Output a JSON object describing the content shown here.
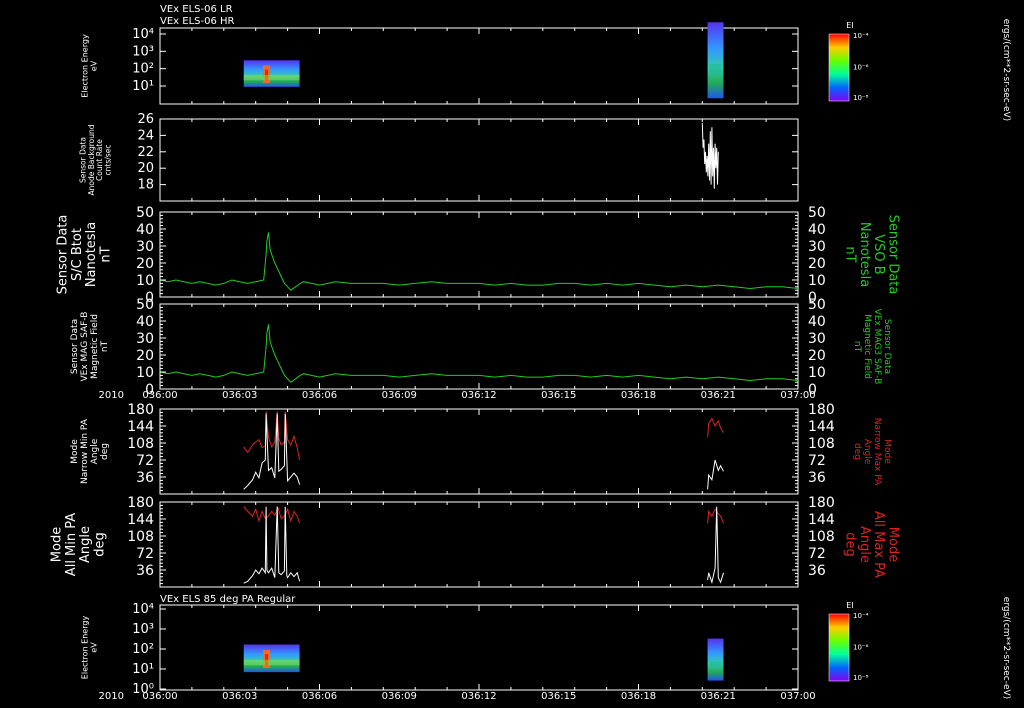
{
  "header": {
    "line1": "VEx ELS-06 LR",
    "line2": "VEx ELS-06 HR"
  },
  "year": "2010",
  "time_ticks": [
    "036:00",
    "036:03",
    "036:06",
    "036:09",
    "036:12",
    "036:15",
    "036:18",
    "036:21",
    "037:00"
  ],
  "colors": {
    "background": "#000000",
    "axis": "#ffffff",
    "mag": "#22cc22",
    "max_pa": "#dd2222",
    "min_pa": "#ffffff",
    "right_label_green": "#22cc22",
    "right_label_red": "#dd2222"
  },
  "colorbar": {
    "label": "EI",
    "ticks": [
      "10⁻⁴",
      "10⁻⁶",
      "10⁻⁸"
    ]
  },
  "colorbar_units": "ergs/(cm**2-sr-sec-eV)",
  "chart_data": [
    {
      "type": "heatmap",
      "id": "spec1",
      "ylabel": [
        "Electron Energy",
        "eV"
      ],
      "yticks": [
        "10⁴",
        "10³",
        "10²",
        "10¹"
      ],
      "ylog": true,
      "ylim": [
        1,
        10000
      ],
      "xlim": [
        "036:00",
        "037:00"
      ],
      "blocks": [
        {
          "t0": 36.0525,
          "t1": 36.0875,
          "e0": 8,
          "e1": 200
        },
        {
          "t0": 36.3433,
          "t1": 36.3533,
          "e0": 2,
          "e1": 20000
        }
      ]
    },
    {
      "type": "line",
      "id": "anode",
      "ylabel": [
        "Sensor Data",
        "Anode Background",
        "Count Rate",
        "cnts/sec"
      ],
      "ylim": [
        16,
        26
      ],
      "yticks": [
        "26",
        "24",
        "22",
        "20",
        "18"
      ],
      "series": [
        {
          "color": "#ffffff",
          "x": [
            36.34,
            36.3405,
            36.341,
            36.3415,
            36.342,
            36.3425,
            36.343,
            36.3435,
            36.344,
            36.3445,
            36.345,
            36.3455,
            36.346,
            36.3465,
            36.347,
            36.3475,
            36.348,
            36.3485,
            36.349,
            36.3495,
            36.35
          ],
          "y": [
            25.5,
            22.5,
            23.5,
            20.5,
            22.0,
            19.5,
            21.5,
            19.0,
            23.0,
            18.5,
            24.5,
            18.0,
            25.0,
            19.0,
            22.5,
            17.5,
            23.0,
            20.0,
            22.5,
            18.0,
            22.0
          ]
        }
      ]
    },
    {
      "type": "line",
      "id": "mag1",
      "ylabel": [
        "Sensor Data",
        "S/C Btot",
        "Nanotesla",
        "nT"
      ],
      "rlabel": [
        "Sensor Data",
        "VSO B",
        "Nanotesla",
        "nT"
      ],
      "ylim": [
        0,
        50
      ],
      "yticks": [
        "50",
        "40",
        "30",
        "20",
        "10",
        "0"
      ],
      "series": [
        {
          "color": "#22cc22",
          "x": [
            36.0,
            36.005,
            36.01,
            36.015,
            36.02,
            36.025,
            36.03,
            36.035,
            36.04,
            36.045,
            36.05,
            36.055,
            36.06,
            36.065,
            36.0665,
            36.067,
            36.068,
            36.069,
            36.07,
            36.072,
            36.074,
            36.076,
            36.078,
            36.08,
            36.082,
            36.085,
            36.088,
            36.09,
            36.095,
            36.1,
            36.11,
            36.12,
            36.13,
            36.14,
            36.15,
            36.16,
            36.17,
            36.18,
            36.19,
            36.2,
            36.21,
            36.22,
            36.23,
            36.24,
            36.25,
            36.26,
            36.27,
            36.28,
            36.29,
            36.3,
            36.31,
            36.32,
            36.33,
            36.34,
            36.35,
            36.36,
            36.37,
            36.38,
            36.39,
            36.4
          ],
          "y": [
            10,
            9,
            10,
            9,
            8,
            9,
            8,
            7,
            8,
            10,
            9,
            8,
            9,
            10,
            25,
            33,
            38,
            28,
            25,
            20,
            16,
            12,
            8,
            6,
            4,
            6,
            8,
            9,
            8,
            7,
            9,
            8,
            8,
            8,
            7,
            8,
            9,
            8,
            8,
            8,
            7,
            8,
            7,
            7,
            8,
            8,
            7,
            8,
            7,
            8,
            7,
            6,
            7,
            6,
            7,
            6,
            5,
            6,
            6,
            5
          ]
        }
      ]
    },
    {
      "type": "line",
      "id": "mag2",
      "ylabel": [
        "Sensor Data",
        "VEx MAG SAF-B",
        "Magnetic Field",
        "nT"
      ],
      "rlabel": [
        "Sensor Data",
        "VEx MAG3 SAF-B",
        "Magnetic Field",
        "nT"
      ],
      "ylim": [
        0,
        50
      ],
      "yticks": [
        "50",
        "40",
        "30",
        "20",
        "10",
        "0"
      ],
      "series": [
        {
          "color": "#22cc22",
          "x": [
            36.0,
            36.005,
            36.01,
            36.015,
            36.02,
            36.025,
            36.03,
            36.035,
            36.04,
            36.045,
            36.05,
            36.055,
            36.06,
            36.065,
            36.0665,
            36.067,
            36.068,
            36.069,
            36.07,
            36.072,
            36.074,
            36.076,
            36.078,
            36.08,
            36.082,
            36.085,
            36.088,
            36.09,
            36.095,
            36.1,
            36.11,
            36.12,
            36.13,
            36.14,
            36.15,
            36.16,
            36.17,
            36.18,
            36.19,
            36.2,
            36.21,
            36.22,
            36.23,
            36.24,
            36.25,
            36.26,
            36.27,
            36.28,
            36.29,
            36.3,
            36.31,
            36.32,
            36.33,
            36.34,
            36.35,
            36.36,
            36.37,
            36.38,
            36.39,
            36.4
          ],
          "y": [
            10,
            9,
            10,
            9,
            8,
            9,
            8,
            7,
            8,
            10,
            9,
            8,
            9,
            10,
            25,
            33,
            38,
            28,
            25,
            20,
            16,
            12,
            8,
            6,
            4,
            6,
            8,
            9,
            8,
            7,
            9,
            8,
            8,
            8,
            7,
            8,
            9,
            8,
            8,
            8,
            7,
            8,
            7,
            7,
            8,
            8,
            7,
            8,
            7,
            8,
            7,
            6,
            7,
            6,
            7,
            6,
            5,
            6,
            6,
            5
          ]
        }
      ]
    },
    {
      "type": "line",
      "id": "pa_narrow",
      "ylabel": [
        "Mode",
        "Narrow Min PA",
        "Angle",
        "deg"
      ],
      "rlabel": [
        "Mode",
        "Narrow Max PA",
        "Angle",
        "deg"
      ],
      "ylim": [
        0,
        180
      ],
      "yticks": [
        "180",
        "144",
        "108",
        "72",
        "36"
      ],
      "series": [
        {
          "name": "Narrow Max PA",
          "color": "#dd2222",
          "x": [
            36.0525,
            36.055,
            36.058,
            36.06,
            36.062,
            36.064,
            36.066,
            36.0665,
            36.068,
            36.07,
            36.072,
            36.0735,
            36.0745,
            36.076,
            36.078,
            36.0785,
            36.08,
            36.082,
            36.084,
            36.086,
            36.0875
          ],
          "y": [
            100,
            88,
            104,
            110,
            115,
            98,
            102,
            175,
            120,
            100,
            110,
            175,
            118,
            104,
            110,
            175,
            115,
            104,
            122,
            98,
            72
          ]
        },
        {
          "name": "Narrow Min PA",
          "color": "#ffffff",
          "x": [
            36.0525,
            36.055,
            36.058,
            36.06,
            36.062,
            36.064,
            36.066,
            36.0665,
            36.068,
            36.07,
            36.072,
            36.0735,
            36.0745,
            36.076,
            36.078,
            36.0785,
            36.08,
            36.082,
            36.084,
            36.086,
            36.0875
          ],
          "y": [
            10,
            18,
            30,
            46,
            34,
            66,
            72,
            170,
            50,
            56,
            34,
            170,
            48,
            52,
            60,
            170,
            28,
            36,
            44,
            36,
            20
          ]
        },
        {
          "name": "Narrow Max PA",
          "color": "#dd2222",
          "x": [
            36.3433,
            36.344,
            36.346,
            36.348,
            36.35,
            36.3515,
            36.3533
          ],
          "y": [
            120,
            150,
            160,
            144,
            155,
            140,
            130
          ]
        },
        {
          "name": "Narrow Min PA",
          "color": "#ffffff",
          "x": [
            36.3433,
            36.344,
            36.346,
            36.348,
            36.35,
            36.3515,
            36.3533
          ],
          "y": [
            10,
            40,
            30,
            72,
            50,
            60,
            48
          ]
        }
      ]
    },
    {
      "type": "line",
      "id": "pa_all",
      "ylabel": [
        "Mode",
        "All Min PA",
        "Angle",
        "deg"
      ],
      "rlabel": [
        "Mode",
        "All Max PA",
        "Angle",
        "deg"
      ],
      "ylim": [
        0,
        180
      ],
      "yticks": [
        "180",
        "144",
        "108",
        "72",
        "36"
      ],
      "series": [
        {
          "name": "All Max PA",
          "color": "#dd2222",
          "x": [
            36.0525,
            36.055,
            36.058,
            36.06,
            36.062,
            36.064,
            36.066,
            36.068,
            36.07,
            36.072,
            36.074,
            36.076,
            36.078,
            36.08,
            36.082,
            36.084,
            36.086,
            36.0875
          ],
          "y": [
            170,
            160,
            150,
            165,
            140,
            160,
            145,
            150,
            160,
            152,
            168,
            145,
            150,
            165,
            140,
            160,
            150,
            135
          ]
        },
        {
          "name": "All Min PA",
          "color": "#ffffff",
          "x": [
            36.0525,
            36.055,
            36.058,
            36.06,
            36.062,
            36.064,
            36.066,
            36.0665,
            36.067,
            36.068,
            36.07,
            36.072,
            36.0735,
            36.0745,
            36.076,
            36.078,
            36.0785,
            36.0795,
            36.08,
            36.082,
            36.084,
            36.086,
            36.0875
          ],
          "y": [
            8,
            12,
            24,
            36,
            28,
            40,
            30,
            170,
            36,
            30,
            40,
            20,
            170,
            30,
            26,
            34,
            170,
            24,
            20,
            30,
            22,
            30,
            12
          ]
        },
        {
          "name": "All Max PA",
          "color": "#dd2222",
          "x": [
            36.3433,
            36.344,
            36.346,
            36.348,
            36.35,
            36.3515,
            36.3533
          ],
          "y": [
            135,
            160,
            150,
            165,
            155,
            150,
            135
          ]
        },
        {
          "name": "All Min PA",
          "color": "#ffffff",
          "x": [
            36.3433,
            36.344,
            36.346,
            36.348,
            36.349,
            36.35,
            36.3515,
            36.3533
          ],
          "y": [
            15,
            30,
            10,
            40,
            170,
            20,
            10,
            30
          ]
        }
      ]
    },
    {
      "type": "heatmap",
      "id": "spec2",
      "title": "VEx ELS 85 deg PA Regular",
      "ylabel": [
        "Electron Energy",
        "eV"
      ],
      "yticks": [
        "10⁴",
        "10³",
        "10²",
        "10¹",
        "10⁰"
      ],
      "ylog": true,
      "ylim": [
        1,
        20000
      ],
      "blocks": [
        {
          "t0": 36.0525,
          "t1": 36.0875,
          "e0": 8,
          "e1": 200
        },
        {
          "t0": 36.3433,
          "t1": 36.3533,
          "e0": 3,
          "e1": 400
        }
      ]
    }
  ]
}
